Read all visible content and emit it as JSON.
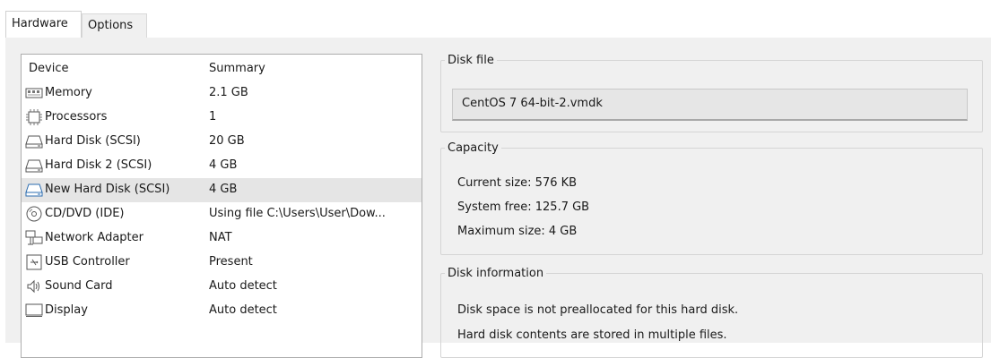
{
  "tabs": [
    {
      "label": "Hardware"
    },
    {
      "label": "Options"
    }
  ],
  "device_list": {
    "headers": {
      "device": "Device",
      "summary": "Summary"
    },
    "rows": [
      {
        "name": "Memory",
        "summary": "2.1 GB",
        "icon": "memory-icon"
      },
      {
        "name": "Processors",
        "summary": "1",
        "icon": "processor-icon"
      },
      {
        "name": "Hard Disk (SCSI)",
        "summary": "20 GB",
        "icon": "hard-disk-icon"
      },
      {
        "name": "Hard Disk 2 (SCSI)",
        "summary": "4 GB",
        "icon": "hard-disk-icon"
      },
      {
        "name": "New Hard Disk (SCSI)",
        "summary": "4 GB",
        "icon": "hard-disk-icon"
      },
      {
        "name": "CD/DVD (IDE)",
        "summary": "Using file C:\\Users\\User\\Dow...",
        "icon": "cd-dvd-icon"
      },
      {
        "name": "Network Adapter",
        "summary": "NAT",
        "icon": "network-adapter-icon"
      },
      {
        "name": "USB Controller",
        "summary": "Present",
        "icon": "usb-icon"
      },
      {
        "name": "Sound Card",
        "summary": "Auto detect",
        "icon": "speaker-icon"
      },
      {
        "name": "Display",
        "summary": "Auto detect",
        "icon": "display-icon"
      }
    ]
  },
  "disk_file": {
    "legend": "Disk file",
    "value": "CentOS 7 64-bit-2.vmdk"
  },
  "capacity": {
    "legend": "Capacity",
    "current": "Current size: 576 KB",
    "system_free": "System free: 125.7 GB",
    "maximum": "Maximum size: 4 GB"
  },
  "disk_info": {
    "legend": "Disk information",
    "line1": "Disk space is not preallocated for this hard disk.",
    "line2": "Hard disk contents are stored in multiple files."
  }
}
